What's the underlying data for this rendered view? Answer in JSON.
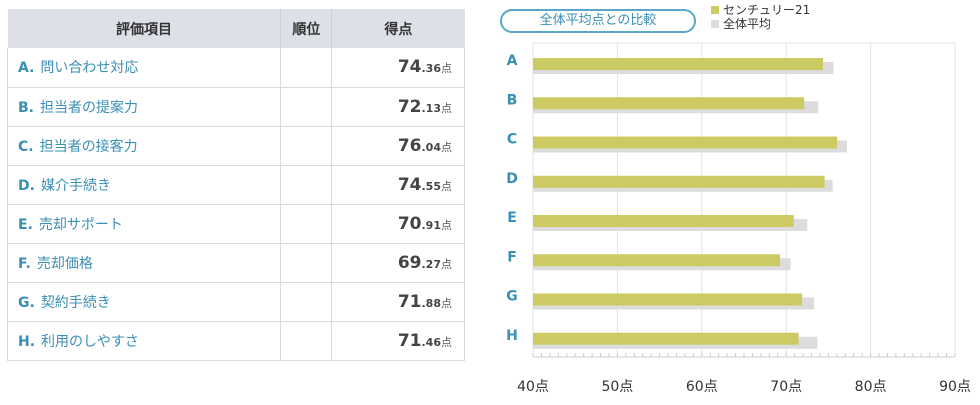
{
  "table": {
    "headers": {
      "item": "評価項目",
      "rank": "順位",
      "score": "得点"
    },
    "rows": [
      {
        "letter": "A.",
        "label": "問い合わせ対応",
        "rank": "",
        "score_int": "74",
        "score_dec": ".36",
        "unit": "点"
      },
      {
        "letter": "B.",
        "label": "担当者の提案力",
        "rank": "",
        "score_int": "72",
        "score_dec": ".13",
        "unit": "点"
      },
      {
        "letter": "C.",
        "label": "担当者の接客力",
        "rank": "",
        "score_int": "76",
        "score_dec": ".04",
        "unit": "点"
      },
      {
        "letter": "D.",
        "label": "媒介手続き",
        "rank": "",
        "score_int": "74",
        "score_dec": ".55",
        "unit": "点"
      },
      {
        "letter": "E.",
        "label": "売却サポート",
        "rank": "",
        "score_int": "70",
        "score_dec": ".91",
        "unit": "点"
      },
      {
        "letter": "F.",
        "label": "売却価格",
        "rank": "",
        "score_int": "69",
        "score_dec": ".27",
        "unit": "点"
      },
      {
        "letter": "G.",
        "label": "契約手続き",
        "rank": "",
        "score_int": "71",
        "score_dec": ".88",
        "unit": "点"
      },
      {
        "letter": "H.",
        "label": "利用のしやすさ",
        "rank": "",
        "score_int": "71",
        "score_dec": ".46",
        "unit": "点"
      }
    ]
  },
  "compare_button": "全体平均点との比較",
  "colors": {
    "company": "#cccb63",
    "average": "#dcdcdc",
    "accent": "#3a8fb5",
    "header_bg": "#dde1e7"
  },
  "chart_data": {
    "type": "bar",
    "orientation": "horizontal",
    "categories": [
      "A",
      "B",
      "C",
      "D",
      "E",
      "F",
      "G",
      "H"
    ],
    "series": [
      {
        "name": "センチュリー21",
        "values": [
          74.36,
          72.13,
          76.04,
          74.55,
          70.91,
          69.27,
          71.88,
          71.46
        ]
      },
      {
        "name": "全体平均",
        "values": [
          75.6,
          73.8,
          77.2,
          75.5,
          72.5,
          70.5,
          73.3,
          73.7
        ]
      }
    ],
    "xlim": [
      40,
      90
    ],
    "xticks": [
      "40点",
      "50点",
      "60点",
      "70点",
      "80点",
      "90点"
    ],
    "xtick_values": [
      40,
      50,
      60,
      70,
      80,
      90
    ],
    "legend_position": "top-right",
    "grid": true
  }
}
